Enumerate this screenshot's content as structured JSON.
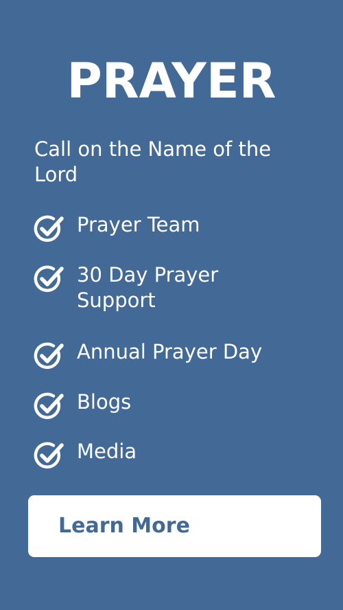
{
  "title": "PRAYER",
  "subtitle": "Call on the Name of the Lord",
  "items": [
    {
      "label": "Prayer Team",
      "icon": "check-circle-icon"
    },
    {
      "label": "30 Day Prayer Support",
      "icon": "check-circle-icon"
    },
    {
      "label": "Annual Prayer Day",
      "icon": "check-circle-icon"
    },
    {
      "label": "Blogs",
      "icon": "check-circle-icon"
    },
    {
      "label": "Media",
      "icon": "check-circle-icon"
    }
  ],
  "cta": {
    "label": "Learn More"
  },
  "colors": {
    "background": "#436a96",
    "text": "#ffffff",
    "button_bg": "#ffffff",
    "button_text": "#436a96"
  }
}
